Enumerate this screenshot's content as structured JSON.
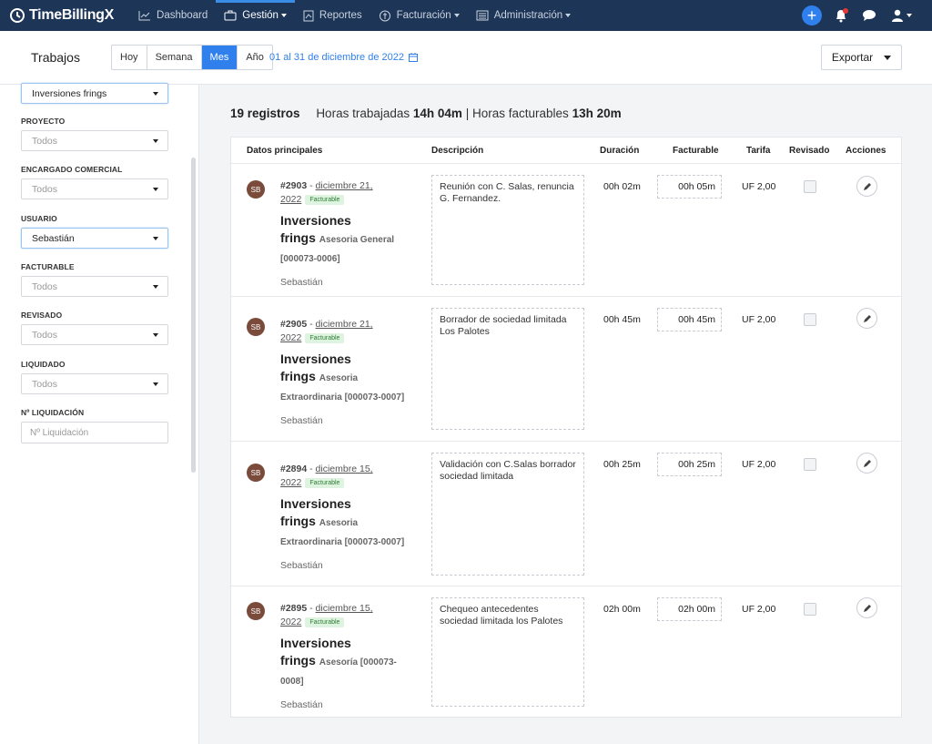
{
  "nav": {
    "logo": "TimeBillingX",
    "items": [
      {
        "label": "Dashboard",
        "icon": "chart-line-icon"
      },
      {
        "label": "Gestión",
        "icon": "briefcase-icon"
      },
      {
        "label": "Reportes",
        "icon": "report-icon"
      },
      {
        "label": "Facturación",
        "icon": "money-icon"
      },
      {
        "label": "Administración",
        "icon": "admin-list-icon"
      }
    ],
    "active": "Gestión",
    "accent": "#2f80ed",
    "bg": "#1d3557"
  },
  "header": {
    "title": "Trabajos",
    "periods": [
      "Hoy",
      "Semana",
      "Mes",
      "Año"
    ],
    "selected_period": "Mes",
    "date_range": "01 al 31 de diciembre de 2022",
    "export_label": "Exportar"
  },
  "filters": {
    "cliente_value": "Inversiones frings",
    "proyecto": {
      "label": "PROYECTO",
      "value": "Todos"
    },
    "encargado": {
      "label": "ENCARGADO COMERCIAL",
      "value": "Todos"
    },
    "usuario": {
      "label": "USUARIO",
      "value": "Sebastián"
    },
    "facturable": {
      "label": "FACTURABLE",
      "value": "Todos"
    },
    "revisado": {
      "label": "REVISADO",
      "value": "Todos"
    },
    "liquidado": {
      "label": "LIQUIDADO",
      "value": "Todos"
    },
    "liquidacion": {
      "label": "Nº LIQUIDACIÓN",
      "placeholder": "Nº Liquidación"
    }
  },
  "summary": {
    "count": "19 registros",
    "worked_label": "Horas trabajadas",
    "worked_value": "14h 04m",
    "separator": "|",
    "billable_label": "Horas facturables",
    "billable_value": "13h 20m"
  },
  "table": {
    "headers": [
      "Datos principales",
      "Descripción",
      "Duración",
      "Facturable",
      "Tarifa",
      "Revisado",
      "Acciones"
    ],
    "rows": [
      {
        "initials": "SB",
        "id": "#2903",
        "sep": " - ",
        "date": "diciembre 21,",
        "year": "2022",
        "badge": "Facturable",
        "client1": "Inversiones",
        "client2": "frings",
        "project": "Asesoria General [000073-0006]",
        "user": "Sebastián",
        "description": "Reunión con C. Salas, renuncia G. Fernandez.",
        "duration": "00h 02m",
        "billable": "00h 05m",
        "rate": "UF 2,00"
      },
      {
        "initials": "SB",
        "id": "#2905",
        "sep": " - ",
        "date": "diciembre 21,",
        "year": "2022",
        "badge": "Facturable",
        "client1": "Inversiones",
        "client2": "frings",
        "project": "Asesoria Extraordinaria [000073-0007]",
        "user": "Sebastián",
        "description": "Borrador de sociedad limitada Los Palotes",
        "duration": "00h 45m",
        "billable": "00h 45m",
        "rate": "UF 2,00"
      },
      {
        "initials": "SB",
        "id": "#2894",
        "sep": " - ",
        "date": "diciembre 15,",
        "year": "2022",
        "badge": "Facturable",
        "client1": "Inversiones",
        "client2": "frings",
        "project": "Asesoria Extraordinaria [000073-0007]",
        "user": "Sebastián",
        "description": "Validación con C.Salas borrador sociedad limitada",
        "duration": "00h 25m",
        "billable": "00h 25m",
        "rate": "UF 2,00"
      },
      {
        "initials": "SB",
        "id": "#2895",
        "sep": " - ",
        "date": "diciembre 15,",
        "year": "2022",
        "badge": "Facturable",
        "client1": "Inversiones",
        "client2": "frings",
        "project": "Asesoría [000073-0008]",
        "user": "Sebastián",
        "description": "Chequeo antecedentes sociedad limitada los Palotes",
        "duration": "02h 00m",
        "billable": "02h 00m",
        "rate": "UF 2,00"
      }
    ]
  }
}
